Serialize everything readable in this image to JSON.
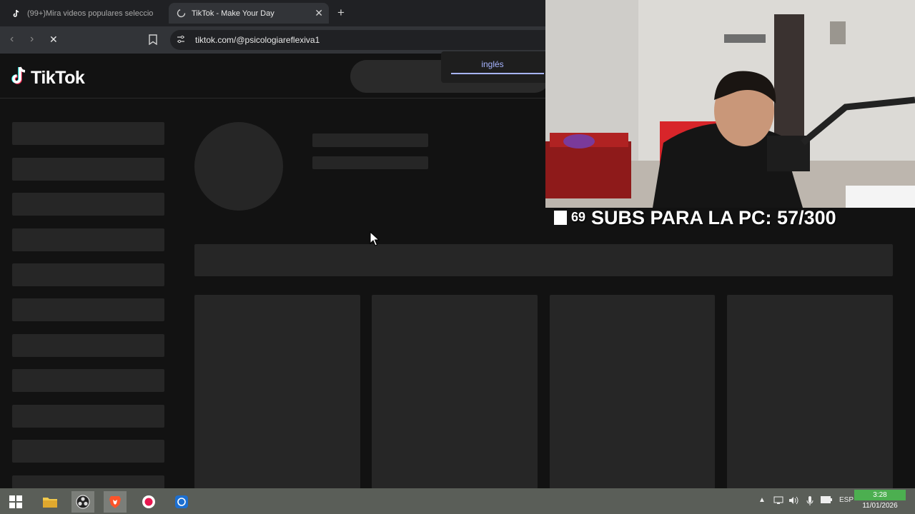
{
  "browser": {
    "tabs": [
      {
        "label": "(99+)Mira videos populares seleccio",
        "favicon": "tiktok-icon"
      },
      {
        "label": "TikTok - Make Your Day",
        "favicon": "loading-icon"
      }
    ],
    "url": "tiktok.com/@psicologiareflexiva1"
  },
  "page": {
    "logo_text": "TikTok",
    "language_option": "inglés"
  },
  "overlay": {
    "sub_count": "69",
    "goal_text": "SUBS PARA LA PC: 57/300"
  },
  "taskbar": {
    "language": "ESP",
    "time": "3:28",
    "date": "11/01/2026",
    "icons": [
      "windows-start-icon",
      "file-explorer-icon",
      "obs-icon",
      "brave-icon",
      "app-icon",
      "app-icon"
    ]
  },
  "colors": {
    "accent_link": "#a7b4ff",
    "page_bg": "#121212",
    "skeleton": "#262626"
  }
}
